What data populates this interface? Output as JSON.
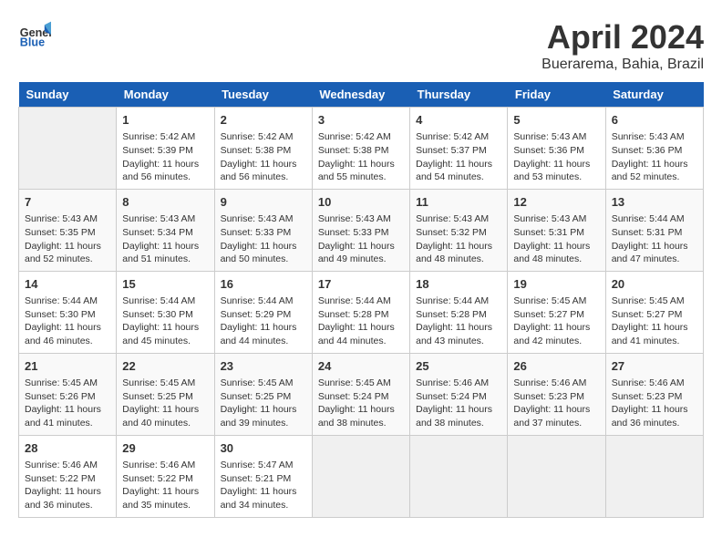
{
  "header": {
    "logo_line1": "General",
    "logo_line2": "Blue",
    "title": "April 2024",
    "location": "Buerarema, Bahia, Brazil"
  },
  "weekdays": [
    "Sunday",
    "Monday",
    "Tuesday",
    "Wednesday",
    "Thursday",
    "Friday",
    "Saturday"
  ],
  "weeks": [
    [
      {
        "day": "",
        "info": ""
      },
      {
        "day": "1",
        "info": "Sunrise: 5:42 AM\nSunset: 5:39 PM\nDaylight: 11 hours\nand 56 minutes."
      },
      {
        "day": "2",
        "info": "Sunrise: 5:42 AM\nSunset: 5:38 PM\nDaylight: 11 hours\nand 56 minutes."
      },
      {
        "day": "3",
        "info": "Sunrise: 5:42 AM\nSunset: 5:38 PM\nDaylight: 11 hours\nand 55 minutes."
      },
      {
        "day": "4",
        "info": "Sunrise: 5:42 AM\nSunset: 5:37 PM\nDaylight: 11 hours\nand 54 minutes."
      },
      {
        "day": "5",
        "info": "Sunrise: 5:43 AM\nSunset: 5:36 PM\nDaylight: 11 hours\nand 53 minutes."
      },
      {
        "day": "6",
        "info": "Sunrise: 5:43 AM\nSunset: 5:36 PM\nDaylight: 11 hours\nand 52 minutes."
      }
    ],
    [
      {
        "day": "7",
        "info": "Sunrise: 5:43 AM\nSunset: 5:35 PM\nDaylight: 11 hours\nand 52 minutes."
      },
      {
        "day": "8",
        "info": "Sunrise: 5:43 AM\nSunset: 5:34 PM\nDaylight: 11 hours\nand 51 minutes."
      },
      {
        "day": "9",
        "info": "Sunrise: 5:43 AM\nSunset: 5:33 PM\nDaylight: 11 hours\nand 50 minutes."
      },
      {
        "day": "10",
        "info": "Sunrise: 5:43 AM\nSunset: 5:33 PM\nDaylight: 11 hours\nand 49 minutes."
      },
      {
        "day": "11",
        "info": "Sunrise: 5:43 AM\nSunset: 5:32 PM\nDaylight: 11 hours\nand 48 minutes."
      },
      {
        "day": "12",
        "info": "Sunrise: 5:43 AM\nSunset: 5:31 PM\nDaylight: 11 hours\nand 48 minutes."
      },
      {
        "day": "13",
        "info": "Sunrise: 5:44 AM\nSunset: 5:31 PM\nDaylight: 11 hours\nand 47 minutes."
      }
    ],
    [
      {
        "day": "14",
        "info": "Sunrise: 5:44 AM\nSunset: 5:30 PM\nDaylight: 11 hours\nand 46 minutes."
      },
      {
        "day": "15",
        "info": "Sunrise: 5:44 AM\nSunset: 5:30 PM\nDaylight: 11 hours\nand 45 minutes."
      },
      {
        "day": "16",
        "info": "Sunrise: 5:44 AM\nSunset: 5:29 PM\nDaylight: 11 hours\nand 44 minutes."
      },
      {
        "day": "17",
        "info": "Sunrise: 5:44 AM\nSunset: 5:28 PM\nDaylight: 11 hours\nand 44 minutes."
      },
      {
        "day": "18",
        "info": "Sunrise: 5:44 AM\nSunset: 5:28 PM\nDaylight: 11 hours\nand 43 minutes."
      },
      {
        "day": "19",
        "info": "Sunrise: 5:45 AM\nSunset: 5:27 PM\nDaylight: 11 hours\nand 42 minutes."
      },
      {
        "day": "20",
        "info": "Sunrise: 5:45 AM\nSunset: 5:27 PM\nDaylight: 11 hours\nand 41 minutes."
      }
    ],
    [
      {
        "day": "21",
        "info": "Sunrise: 5:45 AM\nSunset: 5:26 PM\nDaylight: 11 hours\nand 41 minutes."
      },
      {
        "day": "22",
        "info": "Sunrise: 5:45 AM\nSunset: 5:25 PM\nDaylight: 11 hours\nand 40 minutes."
      },
      {
        "day": "23",
        "info": "Sunrise: 5:45 AM\nSunset: 5:25 PM\nDaylight: 11 hours\nand 39 minutes."
      },
      {
        "day": "24",
        "info": "Sunrise: 5:45 AM\nSunset: 5:24 PM\nDaylight: 11 hours\nand 38 minutes."
      },
      {
        "day": "25",
        "info": "Sunrise: 5:46 AM\nSunset: 5:24 PM\nDaylight: 11 hours\nand 38 minutes."
      },
      {
        "day": "26",
        "info": "Sunrise: 5:46 AM\nSunset: 5:23 PM\nDaylight: 11 hours\nand 37 minutes."
      },
      {
        "day": "27",
        "info": "Sunrise: 5:46 AM\nSunset: 5:23 PM\nDaylight: 11 hours\nand 36 minutes."
      }
    ],
    [
      {
        "day": "28",
        "info": "Sunrise: 5:46 AM\nSunset: 5:22 PM\nDaylight: 11 hours\nand 36 minutes."
      },
      {
        "day": "29",
        "info": "Sunrise: 5:46 AM\nSunset: 5:22 PM\nDaylight: 11 hours\nand 35 minutes."
      },
      {
        "day": "30",
        "info": "Sunrise: 5:47 AM\nSunset: 5:21 PM\nDaylight: 11 hours\nand 34 minutes."
      },
      {
        "day": "",
        "info": ""
      },
      {
        "day": "",
        "info": ""
      },
      {
        "day": "",
        "info": ""
      },
      {
        "day": "",
        "info": ""
      }
    ]
  ]
}
